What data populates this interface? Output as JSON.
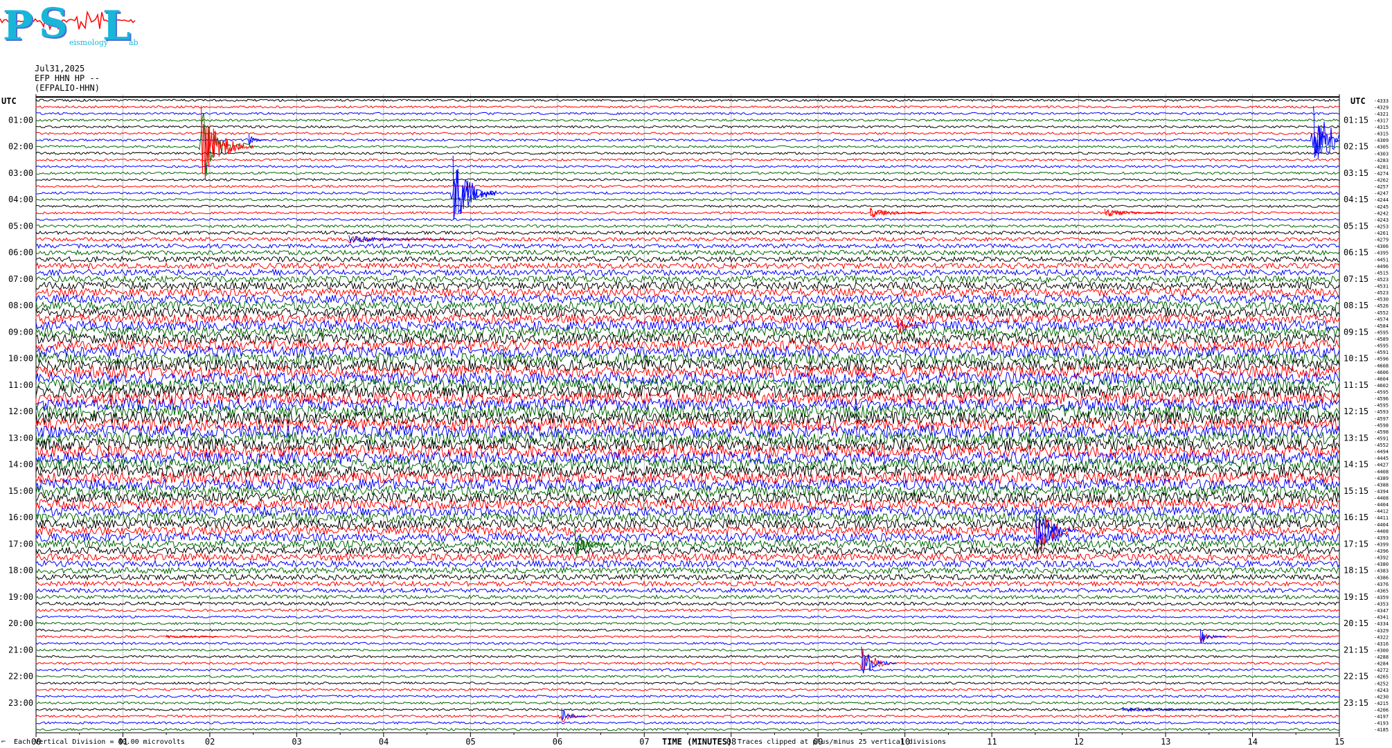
{
  "logo": {
    "letters": [
      "P",
      "S",
      "L"
    ],
    "tiny_words": [
      "",
      "eismology",
      "ab"
    ],
    "colors": {
      "letters": "#19b6d9",
      "shadow": "#4d6fd6",
      "wave": "#ff0000"
    }
  },
  "header": {
    "date": "Jul31,2025",
    "station": "EFP HHN HP --",
    "channel": "(EFPALIO-HHN)"
  },
  "footer": {
    "scale_text": "Each Vertical Division =   40.00 microvolts",
    "clip_text": "Traces clipped at plus/minus 25 vertical divisions",
    "left_mark": "⌐"
  },
  "chart_data": {
    "type": "line",
    "title": "",
    "xlabel": "TIME (MINUTES)",
    "ylabel": "",
    "x_ticks": [
      "00",
      "01",
      "02",
      "03",
      "04",
      "05",
      "06",
      "07",
      "08",
      "09",
      "10",
      "11",
      "12",
      "13",
      "14",
      "15"
    ],
    "xlim": [
      0,
      15
    ],
    "left_axis_title": "UTC",
    "right_axis_title": "UTC",
    "left_hour_labels": [
      "01:00",
      "02:00",
      "03:00",
      "04:00",
      "05:00",
      "06:00",
      "07:00",
      "08:00",
      "09:00",
      "10:00",
      "11:00",
      "12:00",
      "13:00",
      "14:00",
      "15:00",
      "16:00",
      "17:00",
      "18:00",
      "19:00",
      "20:00",
      "21:00",
      "22:00",
      "23:00"
    ],
    "right_hour_labels": [
      "01:15",
      "02:15",
      "03:15",
      "04:15",
      "05:15",
      "06:15",
      "07:15",
      "08:15",
      "09:15",
      "10:15",
      "11:15",
      "12:15",
      "13:15",
      "14:15",
      "15:15",
      "16:15",
      "17:15",
      "18:15",
      "19:15",
      "20:15",
      "21:15",
      "22:15",
      "23:15"
    ],
    "trace_colors": [
      "#000000",
      "#ff0000",
      "#0000ff",
      "#006600"
    ],
    "traces_per_hour": 4,
    "trace_count": 96,
    "trace_offsets": [
      -4333,
      -4329,
      -4321,
      -4317,
      -4315,
      -4315,
      -4309,
      -4305,
      -4303,
      -4283,
      -4281,
      -4274,
      -4262,
      -4257,
      -4247,
      -4244,
      -4245,
      -4242,
      -4243,
      -4253,
      -4261,
      -4279,
      -4306,
      -4395,
      -4451,
      -4496,
      -4515,
      -4523,
      -4531,
      -4523,
      -4530,
      -4526,
      -4552,
      -4574,
      -4584,
      -4595,
      -4589,
      -4595,
      -4591,
      -4596,
      -4608,
      -4606,
      -4604,
      -4602,
      -4595,
      -4596,
      -4595,
      -4593,
      -4597,
      -4598,
      -4598,
      -4591,
      -4552,
      -4494,
      -4445,
      -4427,
      -4408,
      -4389,
      -4388,
      -4394,
      -4408,
      -4404,
      -4412,
      -4411,
      -4404,
      -4408,
      -4393,
      -4399,
      -4396,
      -4392,
      -4380,
      -4383,
      -4386,
      -4376,
      -4365,
      -4359,
      -4353,
      -4347,
      -4341,
      -4334,
      -4329,
      -4322,
      -4316,
      -4300,
      -4288,
      -4284,
      -4272,
      -4265,
      -4252,
      -4243,
      -4230,
      -4215,
      -4206,
      -4197,
      -4193,
      -4185
    ],
    "vertical_division_microvolts": 40.0,
    "clip_divisions": 25,
    "events": [
      {
        "minute": 1.9,
        "trace": 7,
        "color": "#ff0000",
        "amplitude": 60,
        "duration": 0.6
      },
      {
        "minute": 2.45,
        "trace": 6,
        "color": "#0000ff",
        "amplitude": 8,
        "duration": 0.2
      },
      {
        "minute": 4.8,
        "trace": 14,
        "color": "#0000ff",
        "amplitude": 55,
        "duration": 0.5
      },
      {
        "minute": 14.7,
        "trace": 6,
        "color": "#0000ff",
        "amplitude": 50,
        "duration": 0.6
      },
      {
        "minute": 3.6,
        "trace": 21,
        "color": "#0000ff",
        "amplitude": 6,
        "duration": 1.2
      },
      {
        "minute": 12.3,
        "trace": 17,
        "color": "#ff0000",
        "amplitude": 6,
        "duration": 0.8
      },
      {
        "minute": 9.6,
        "trace": 17,
        "color": "#ff0000",
        "amplitude": 7,
        "duration": 0.7
      },
      {
        "minute": 11.5,
        "trace": 65,
        "color": "#0000ff",
        "amplitude": 45,
        "duration": 0.5
      },
      {
        "minute": 9.5,
        "trace": 85,
        "color": "#0000ff",
        "amplitude": 25,
        "duration": 0.4
      },
      {
        "minute": 6.2,
        "trace": 67,
        "color": "#006600",
        "amplitude": 25,
        "duration": 0.4
      },
      {
        "minute": 6.05,
        "trace": 93,
        "color": "#0000ff",
        "amplitude": 12,
        "duration": 0.3
      },
      {
        "minute": 13.4,
        "trace": 81,
        "color": "#0000ff",
        "amplitude": 12,
        "duration": 0.3
      },
      {
        "minute": 9.9,
        "trace": 34,
        "color": "#ff0000",
        "amplitude": 18,
        "duration": 0.3
      },
      {
        "minute": 1.5,
        "trace": 81,
        "color": "#ff0000",
        "amplitude": 3,
        "duration": 0.6
      },
      {
        "minute": 12.5,
        "trace": 92,
        "color": "#0000ff",
        "amplitude": 3,
        "duration": 3.0
      }
    ]
  }
}
